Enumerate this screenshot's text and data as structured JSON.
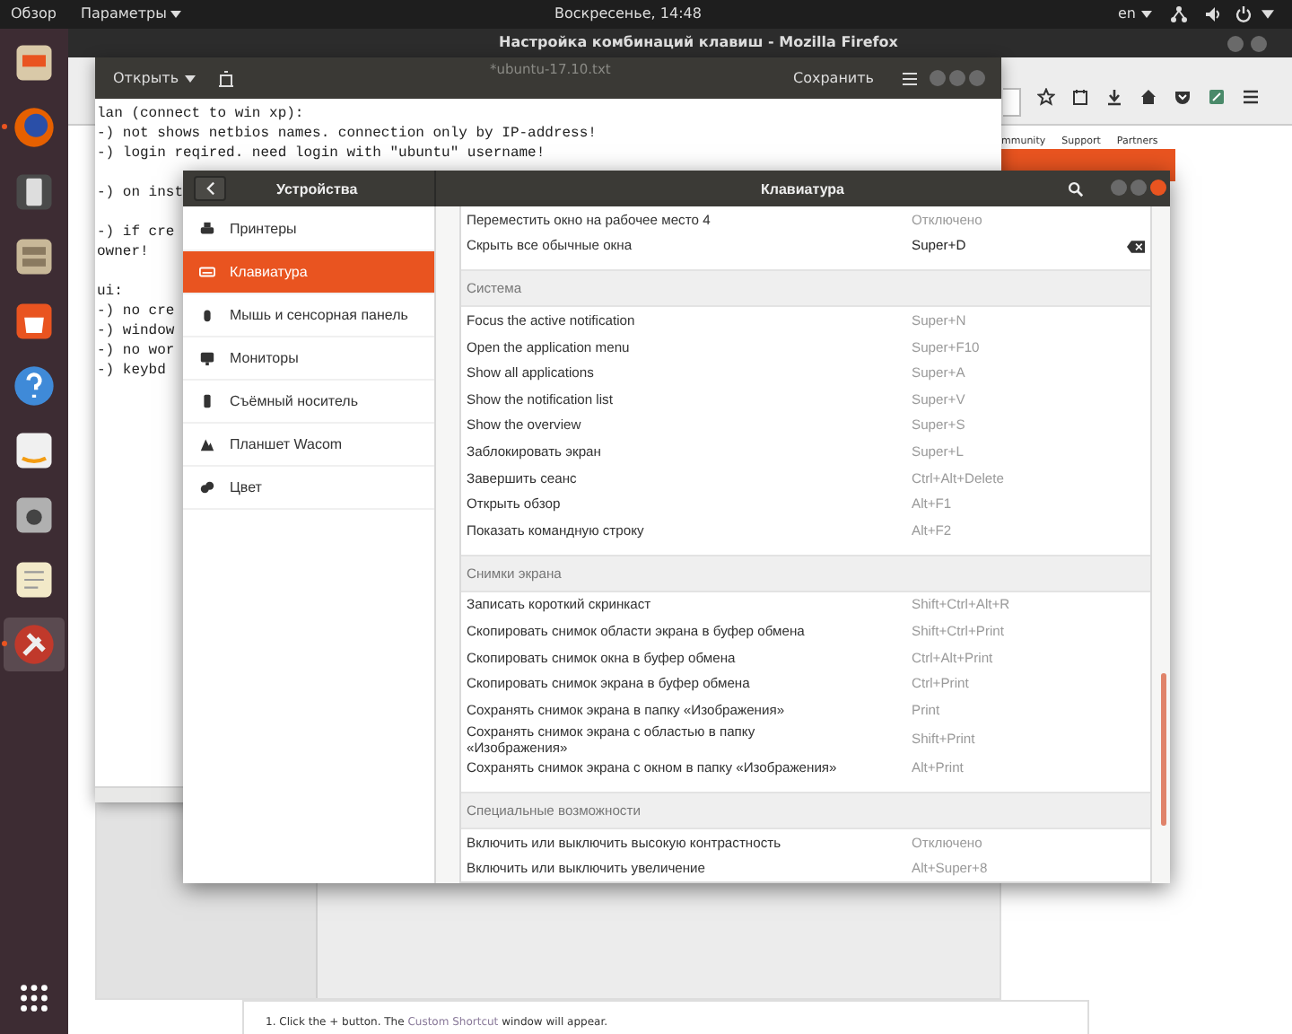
{
  "top_bar": {
    "activities": "Обзор",
    "app_menu": "Параметры",
    "clock": "Воскресенье, 14:48",
    "language": "en"
  },
  "dock": [
    {
      "kind": "archive",
      "running": false,
      "selected": false
    },
    {
      "kind": "browser",
      "running": true,
      "selected": false
    },
    {
      "kind": "device",
      "running": false,
      "selected": false
    },
    {
      "kind": "cabinet",
      "running": false,
      "selected": false
    },
    {
      "kind": "store",
      "running": false,
      "selected": false
    },
    {
      "kind": "help",
      "running": false,
      "selected": false
    },
    {
      "kind": "shop",
      "running": false,
      "selected": false
    },
    {
      "kind": "camera",
      "running": false,
      "selected": false
    },
    {
      "kind": "notepad",
      "running": false,
      "selected": false
    },
    {
      "kind": "tools",
      "running": true,
      "selected": true
    }
  ],
  "browser": {
    "title": "Настройка комбинаций клавиш - Mozilla Firefox",
    "nav_links": [
      "mmunity",
      "Support",
      "Partners"
    ],
    "instruction": {
      "before": "1. Click the + button. The ",
      "link": "Custom Shortcut",
      "after": " window will appear."
    }
  },
  "editor": {
    "open_button": "Открыть",
    "title": "*ubuntu-17.10.txt",
    "save_button": "Сохранить",
    "lines": [
      {
        "text": "lan (connect to win xp):",
        "gap_before": false
      },
      {
        "text": "-) not shows netbios names. connection only by IP-address!",
        "gap_before": false
      },
      {
        "text": "-) login reqired. need login with \"ubuntu\" username!",
        "gap_before": false
      },
      {
        "text": "-) on inst",
        "gap_before": true
      },
      {
        "text": "-) if cre",
        "gap_before": true
      },
      {
        "text": "owner!",
        "gap_before": false
      },
      {
        "text": "ui:",
        "gap_before": true
      },
      {
        "text": "-) no cre",
        "gap_before": false
      },
      {
        "text": "-) window",
        "gap_before": false
      },
      {
        "text": "-) no wor",
        "gap_before": false
      },
      {
        "text": "-) keybd",
        "gap_before": false
      }
    ]
  },
  "settings": {
    "panel_title": "Устройства",
    "page_title": "Клавиатура",
    "devices": [
      {
        "label": "Принтеры",
        "kind": "printer",
        "selected": false
      },
      {
        "label": "Клавиатура",
        "kind": "keyboard",
        "selected": true
      },
      {
        "label": "Мышь и сенсорная панель",
        "kind": "mouse",
        "selected": false
      },
      {
        "label": "Мониторы",
        "kind": "monitor",
        "selected": false
      },
      {
        "label": "Съёмный носитель",
        "kind": "drive",
        "selected": false
      },
      {
        "label": "Планшет Wacom",
        "kind": "tablet",
        "selected": false
      },
      {
        "label": "Цвет",
        "kind": "color",
        "selected": false
      }
    ],
    "shortcut_groups": [
      {
        "rows": [
          {
            "name": "Переместить окно на рабочее место 4",
            "accel": "Отключено",
            "modified": false
          },
          {
            "name": "Скрыть все обычные окна",
            "accel": "Super+D",
            "modified": true
          }
        ]
      },
      {
        "heading": "Система",
        "rows": [
          {
            "name": "Focus the active notification",
            "accel": "Super+N",
            "modified": false
          },
          {
            "name": "Open the application menu",
            "accel": "Super+F10",
            "modified": false
          },
          {
            "name": "Show all applications",
            "accel": "Super+A",
            "modified": false
          },
          {
            "name": "Show the notification list",
            "accel": "Super+V",
            "modified": false
          },
          {
            "name": "Show the overview",
            "accel": "Super+S",
            "modified": false
          },
          {
            "name": "Заблокировать экран",
            "accel": "Super+L",
            "modified": false
          },
          {
            "name": "Завершить сеанс",
            "accel": "Ctrl+Alt+Delete",
            "modified": false
          },
          {
            "name": "Открыть обзор",
            "accel": "Alt+F1",
            "modified": false
          },
          {
            "name": "Показать командную строку",
            "accel": "Alt+F2",
            "modified": false
          }
        ]
      },
      {
        "heading": "Снимки экрана",
        "rows": [
          {
            "name": "Записать короткий скринкаст",
            "accel": "Shift+Ctrl+Alt+R",
            "modified": false
          },
          {
            "name": "Скопировать снимок области экрана в буфер обмена",
            "accel": "Shift+Ctrl+Print",
            "modified": false
          },
          {
            "name": "Скопировать снимок окна в буфер обмена",
            "accel": "Ctrl+Alt+Print",
            "modified": false
          },
          {
            "name": "Скопировать снимок экрана в буфер обмена",
            "accel": "Ctrl+Print",
            "modified": false
          },
          {
            "name": "Сохранять снимок экрана в папку «Изображения»",
            "accel": "Print",
            "modified": false
          },
          {
            "name": "Сохранять снимок экрана с областью в папку\n«Изображения»",
            "accel": "Shift+Print",
            "modified": false
          },
          {
            "name": "Сохранять снимок экрана с окном в папку «Изображения»",
            "accel": "Alt+Print",
            "modified": false
          }
        ]
      },
      {
        "heading": "Специальные возможности",
        "rows": [
          {
            "name": "Включить или выключить высокую контрастность",
            "accel": "Отключено",
            "modified": false
          },
          {
            "name": "Включить или выключить увеличение",
            "accel": "Alt+Super+8",
            "modified": false
          }
        ]
      }
    ]
  }
}
